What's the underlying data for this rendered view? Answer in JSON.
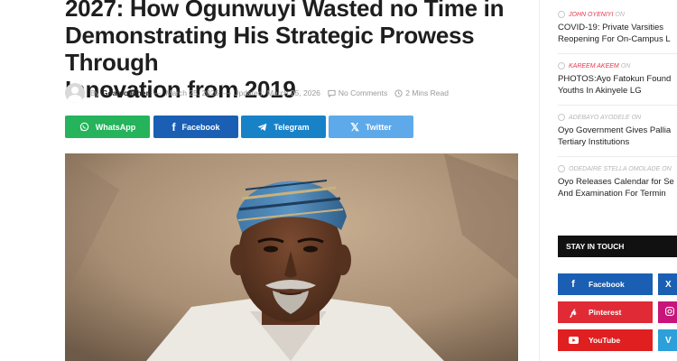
{
  "article": {
    "headline_lines": [
      "2027: How Ogunwuyi Wasted no Time in",
      "Demonstrating His Strategic Prowess Through",
      "Innovation from 2019"
    ],
    "by_label": "By",
    "author": "Goalpoacher",
    "dash": "—",
    "published": "March 25, 2026",
    "updated_label": "— Updated:",
    "updated": "March 25, 2026",
    "comments": "No Comments",
    "read_time": "2 Mins Read"
  },
  "share_buttons": [
    {
      "label": "WhatsApp",
      "color": "#25b35b",
      "icon": "whatsapp-icon"
    },
    {
      "label": "Facebook",
      "color": "#1a5fb4",
      "icon": "facebook-icon"
    },
    {
      "label": "Telegram",
      "color": "#1782c8",
      "icon": "telegram-icon"
    },
    {
      "label": "Twitter",
      "color": "#5ea9e9",
      "icon": "x-icon"
    }
  ],
  "sidebar": {
    "posts": [
      {
        "author": "JOHN OYENIYI",
        "on": "on",
        "title_lines": [
          "COVID-19: Private Varsities",
          "Reopening For On-Campus L"
        ]
      },
      {
        "author": "KAREEM AKEEM",
        "on": "on",
        "title_lines": [
          "PHOTOS:Ayo Fatokun Found",
          "Youths In Akinyele LG"
        ]
      },
      {
        "author": "ADEBAYO AYODELE",
        "on": "on",
        "title_lines": [
          "Oyo Government Gives Pallia",
          "Tertiary Institutions"
        ]
      },
      {
        "author": "ODEDAIRE STELLA OMOLADE",
        "on": "on",
        "title_lines": [
          "Oyo Releases Calendar for Se",
          "And Examination For Termin"
        ]
      }
    ],
    "stay_in_touch": "STAY IN TOUCH",
    "social": [
      {
        "label": "Facebook",
        "color": "#1a5fb4",
        "icon": "facebook-icon"
      },
      {
        "label": "Pinterest",
        "color": "#e02b36",
        "icon": "pinterest-icon"
      },
      {
        "label": "YouTube",
        "color": "#e02020",
        "icon": "youtube-icon"
      }
    ],
    "social_right": [
      {
        "label": "X",
        "color": "#1a5fb4",
        "icon": "x-icon"
      },
      {
        "label": "",
        "color": "#c9157a",
        "icon": "instagram-icon"
      },
      {
        "label": "V",
        "color": "#2d9fd9",
        "icon": "vimeo-icon"
      }
    ]
  },
  "colors": {
    "accent": "#e7364c",
    "text": "#1e1e1e",
    "muted": "#9a9a9a"
  }
}
